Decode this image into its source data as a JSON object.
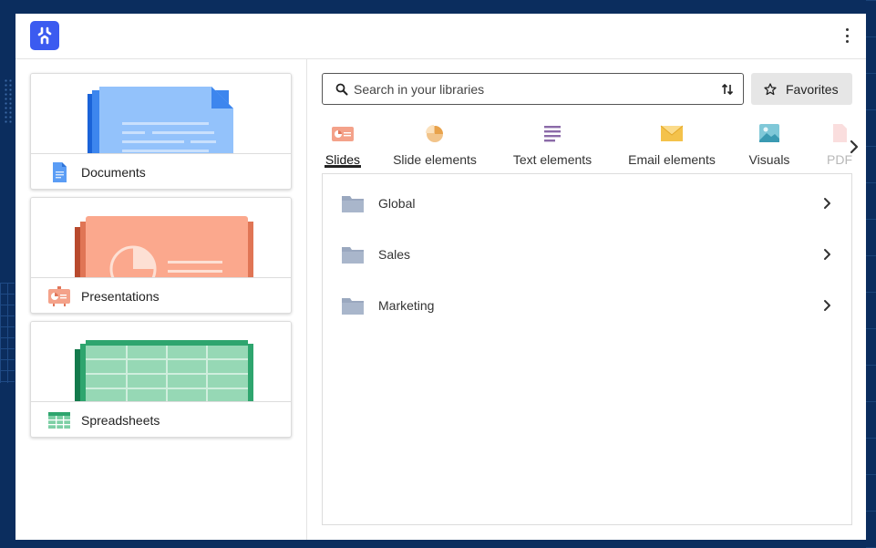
{
  "header": {
    "logo_icon": "app-logo",
    "menu_icon": "kebab-menu-icon"
  },
  "categories": [
    {
      "label": "Documents",
      "icon": "document-icon",
      "color": "#5b9df5"
    },
    {
      "label": "Presentations",
      "icon": "presentation-icon",
      "color": "#f4a28a"
    },
    {
      "label": "Spreadsheets",
      "icon": "spreadsheet-icon",
      "color": "#2ea56e"
    }
  ],
  "search": {
    "placeholder": "Search in your libraries",
    "value": ""
  },
  "favorites": {
    "label": "Favorites"
  },
  "tabs": [
    {
      "label": "Slides",
      "active": true
    },
    {
      "label": "Slide elements",
      "active": false
    },
    {
      "label": "Text elements",
      "active": false
    },
    {
      "label": "Email elements",
      "active": false
    },
    {
      "label": "Visuals",
      "active": false
    },
    {
      "label": "PDF",
      "active": false
    }
  ],
  "folders": [
    {
      "label": "Global"
    },
    {
      "label": "Sales"
    },
    {
      "label": "Marketing"
    }
  ]
}
